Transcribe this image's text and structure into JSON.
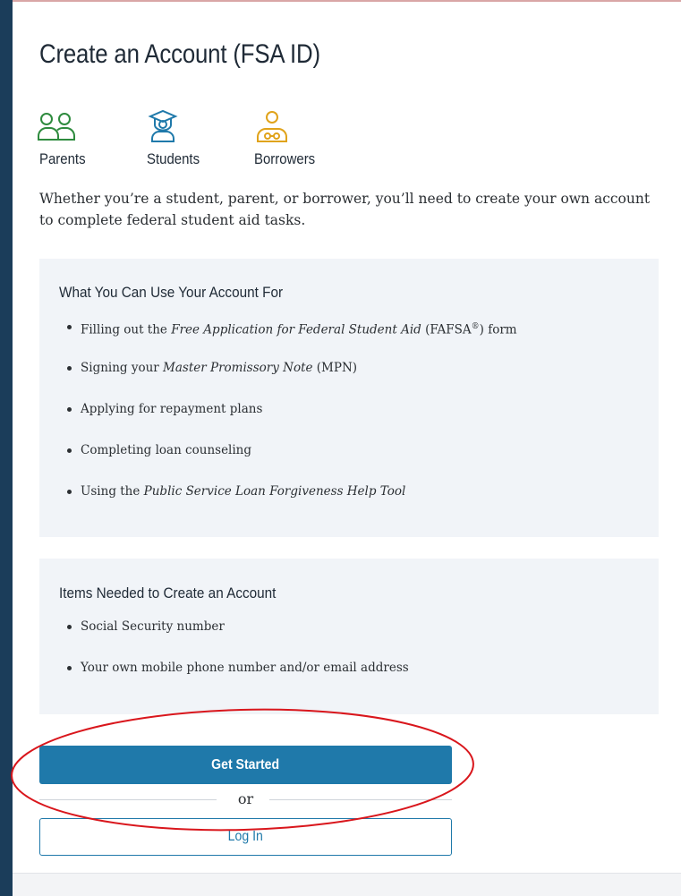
{
  "page": {
    "title": "Create an Account (FSA ID)",
    "roles": [
      {
        "label": "Parents",
        "icon": "parents-icon",
        "color": "#2e8b3e"
      },
      {
        "label": "Students",
        "icon": "students-icon",
        "color": "#1f79aa"
      },
      {
        "label": "Borrowers",
        "icon": "borrowers-icon",
        "color": "#e0a31a"
      }
    ],
    "intro": "Whether you’re a student, parent, or borrower, you’ll need to create your own account to complete federal student aid tasks."
  },
  "uses_panel": {
    "heading": "What You Can Use Your Account For",
    "items": [
      {
        "pre": "Filling out the ",
        "em": "Free Application for Federal Student Aid",
        "post": " (FAFSA",
        "sup": "®",
        "post2": ") form"
      },
      {
        "pre": "Signing your ",
        "em": "Master Promissory Note",
        "post": " (MPN)"
      },
      {
        "pre": "Applying for repayment plans"
      },
      {
        "pre": "Completing loan counseling"
      },
      {
        "pre": "Using the ",
        "em": "Public Service Loan Forgiveness Help Tool"
      }
    ]
  },
  "needs_panel": {
    "heading": "Items Needed to Create an Account",
    "items": [
      "Social Security number",
      "Your own mobile phone number and/or email address"
    ]
  },
  "actions": {
    "get_started_label": "Get Started",
    "or_label": "or",
    "login_label": "Log In"
  },
  "colors": {
    "primary": "#1f79aa",
    "annotation": "#d9161c",
    "panel_bg": "#f1f4f8"
  }
}
